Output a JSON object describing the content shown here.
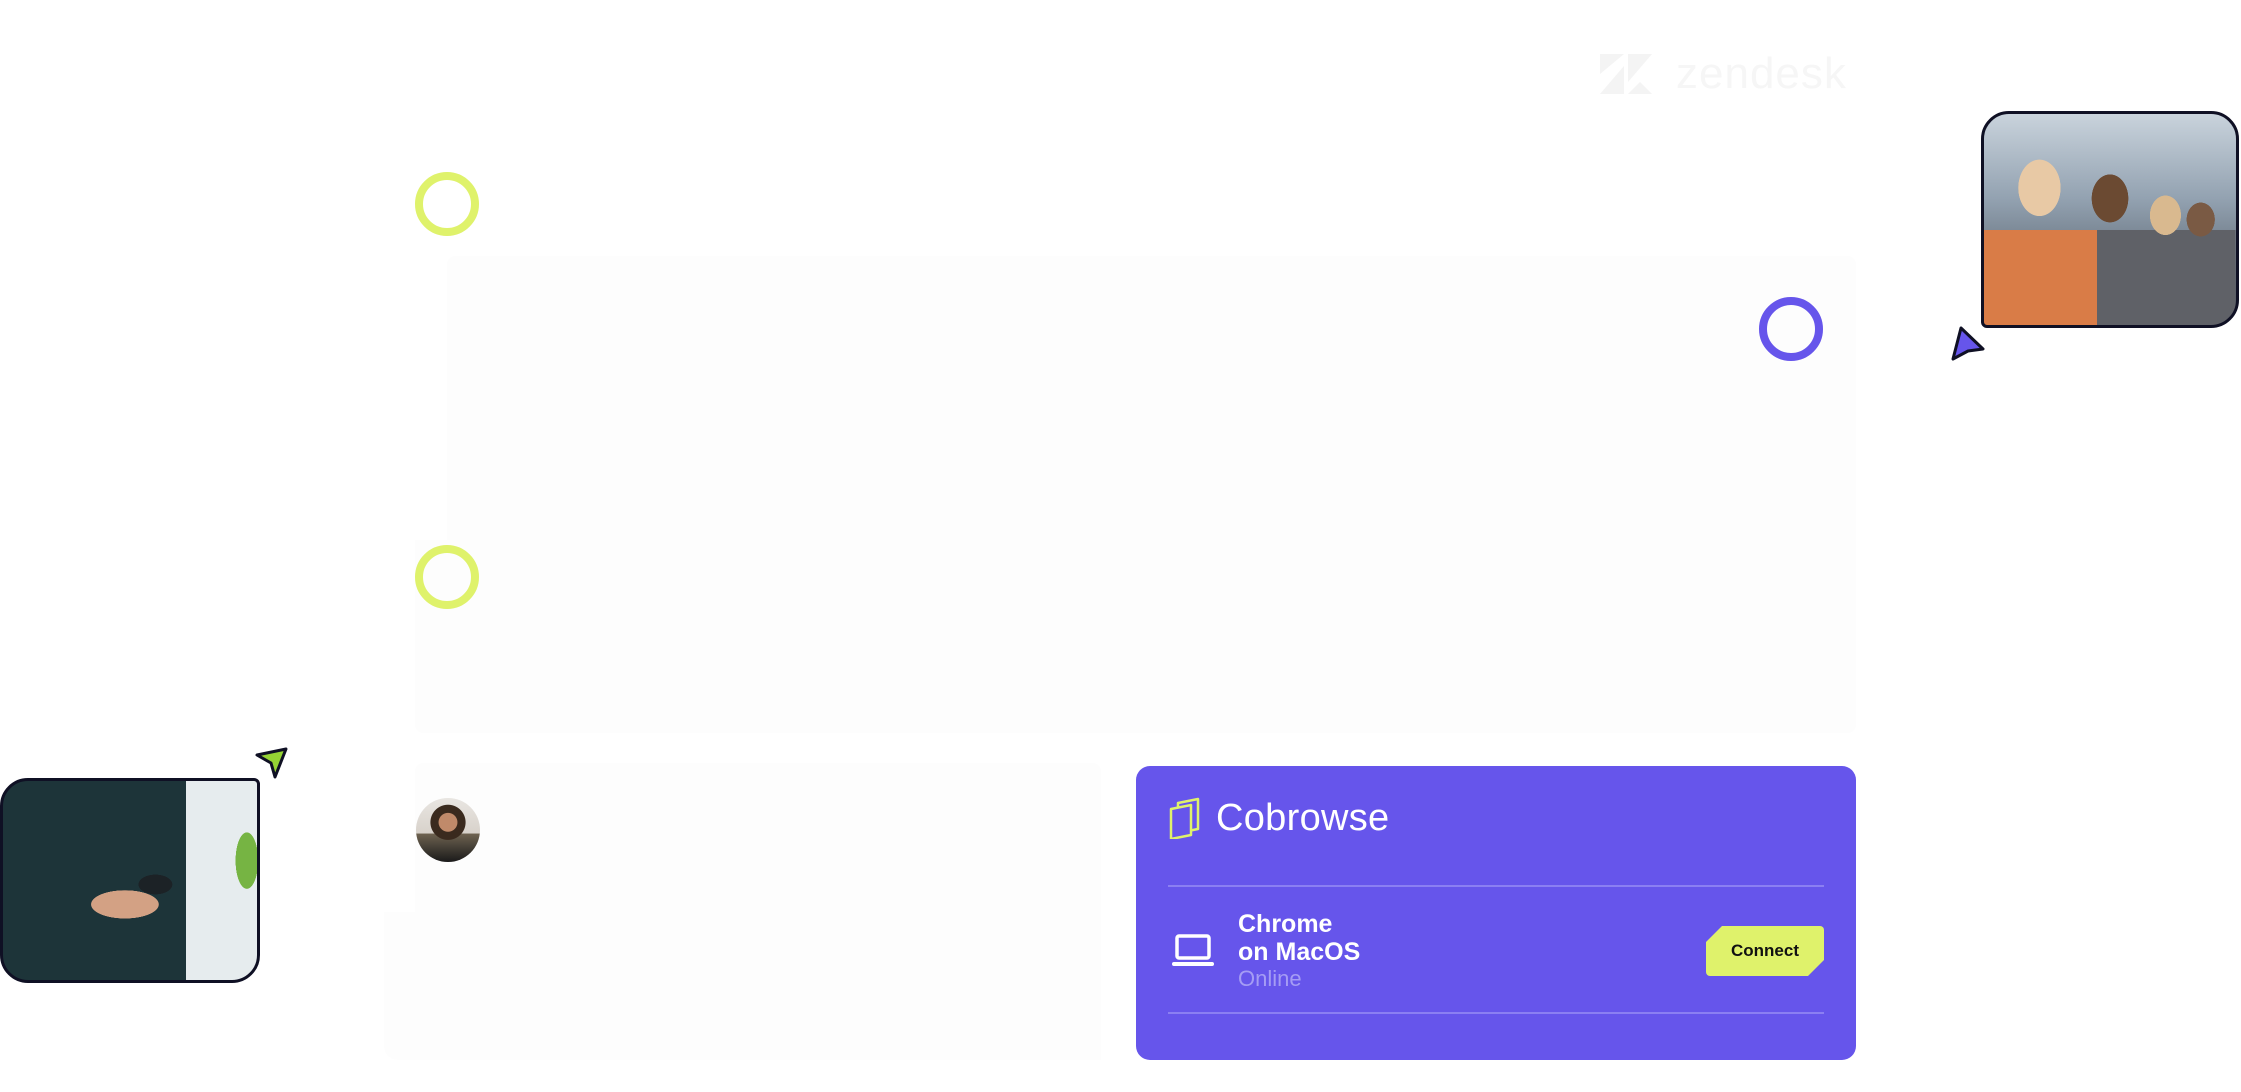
{
  "brand": {
    "partner_logo_text": "zendesk",
    "colors": {
      "accent_purple": "#6655eb",
      "accent_lime": "#dff26b",
      "status_text": "#a59cf4"
    }
  },
  "cobrowse_panel": {
    "title": "Cobrowse",
    "logo_icon": "cobrowse-logo-icon",
    "device": {
      "icon": "laptop-icon",
      "name": "Chrome\non MacOS",
      "status": "Online",
      "action_label": "Connect"
    }
  },
  "decorations": {
    "photos": [
      "call-center-agents-photo",
      "person-using-phone-photo"
    ],
    "avatar": "customer-avatar",
    "cursors": [
      "purple-cursor",
      "green-cursor"
    ]
  }
}
